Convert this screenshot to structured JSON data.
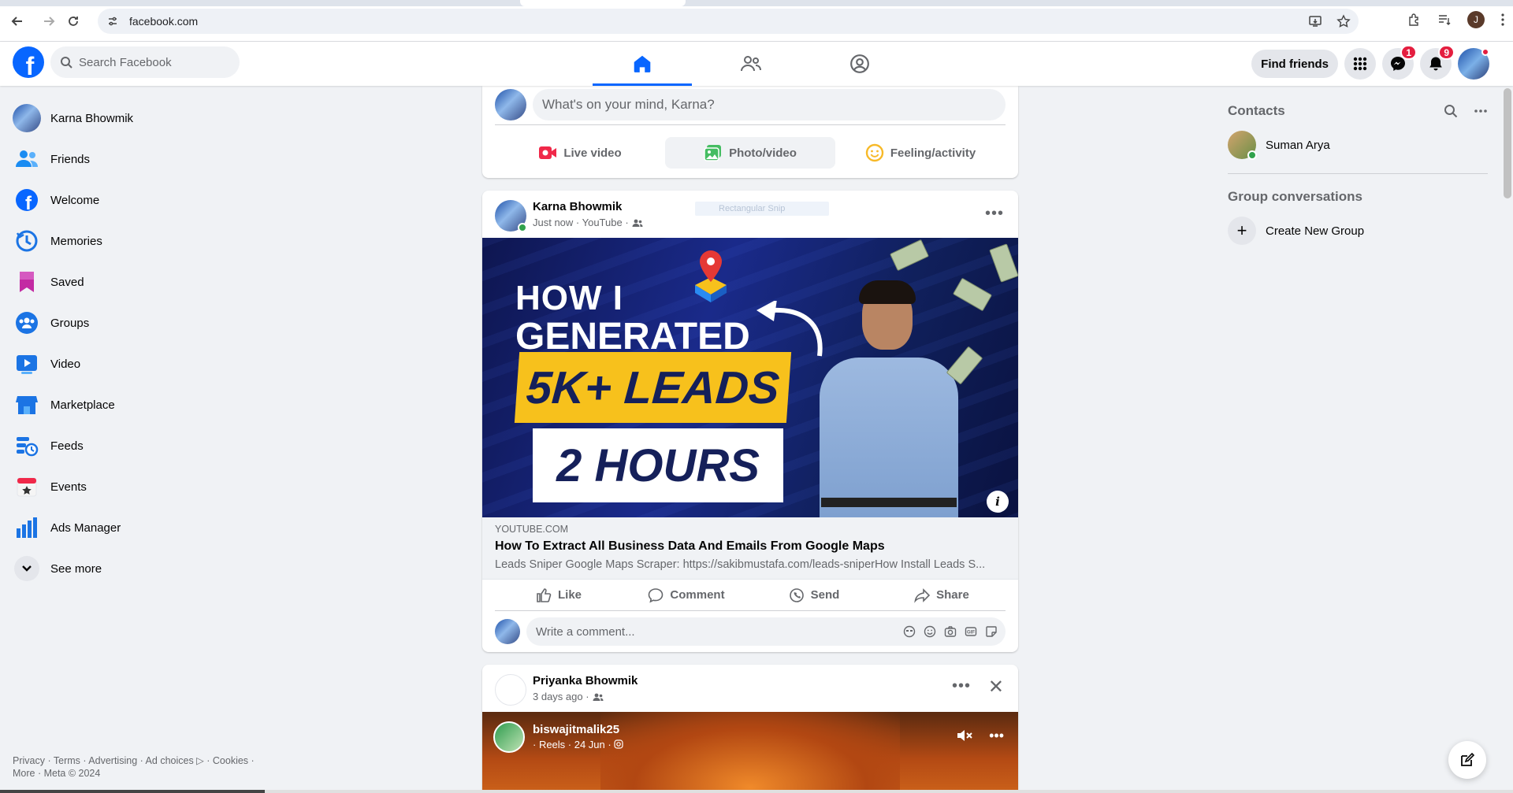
{
  "browser": {
    "url": "facebook.com",
    "avatar_letter": "J"
  },
  "header": {
    "search_placeholder": "Search Facebook",
    "find_friends": "Find friends",
    "messenger_badge": "1",
    "notifications_badge": "9"
  },
  "sidebar": {
    "items": [
      {
        "label": "Karna Bhowmik",
        "icon": "profile-avatar"
      },
      {
        "label": "Friends",
        "icon": "friends-icon"
      },
      {
        "label": "Welcome",
        "icon": "facebook-icon"
      },
      {
        "label": "Memories",
        "icon": "clock-icon"
      },
      {
        "label": "Saved",
        "icon": "bookmark-icon"
      },
      {
        "label": "Groups",
        "icon": "groups-icon"
      },
      {
        "label": "Video",
        "icon": "video-icon"
      },
      {
        "label": "Marketplace",
        "icon": "shop-icon"
      },
      {
        "label": "Feeds",
        "icon": "feeds-icon"
      },
      {
        "label": "Events",
        "icon": "calendar-icon"
      },
      {
        "label": "Ads Manager",
        "icon": "bar-chart-icon"
      },
      {
        "label": "See more",
        "icon": "chevron-down-icon"
      }
    ],
    "footer_line1": "Privacy · Terms · Advertising · Ad choices ▷ · Cookies ·",
    "footer_line2": "More · Meta © 2024"
  },
  "composer": {
    "placeholder": "What's on your mind, Karna?",
    "live": "Live video",
    "photo": "Photo/video",
    "feeling": "Feeling/activity"
  },
  "post1": {
    "author": "Karna Bhowmik",
    "meta": "Just now · YouTube ·",
    "snip_label": "Rectangular Snip",
    "thumb_line1": "HOW I",
    "thumb_line2": "GENERATED",
    "thumb_band": "5K+ LEADS",
    "thumb_box": "2 HOURS",
    "link_domain": "YOUTUBE.COM",
    "link_title": "How To Extract All Business Data And Emails From Google Maps",
    "link_desc": "Leads Sniper Google Maps Scraper: https://sakibmustafa.com/leads-sniperHow Install Leads S...",
    "like": "Like",
    "comment": "Comment",
    "send": "Send",
    "share": "Share",
    "comment_placeholder": "Write a comment..."
  },
  "post2": {
    "author": "Priyanka Bhowmik",
    "meta": "3 days ago ·",
    "reel_user": "biswajitmalik25",
    "reel_meta": "· Reels · 24 Jun ·"
  },
  "contacts": {
    "title": "Contacts",
    "list": [
      {
        "name": "Suman Arya"
      }
    ],
    "group_title": "Group conversations",
    "create_group": "Create New Group"
  },
  "colors": {
    "brand": "#0866ff",
    "badge": "#e41e3f",
    "online": "#31a24c"
  }
}
